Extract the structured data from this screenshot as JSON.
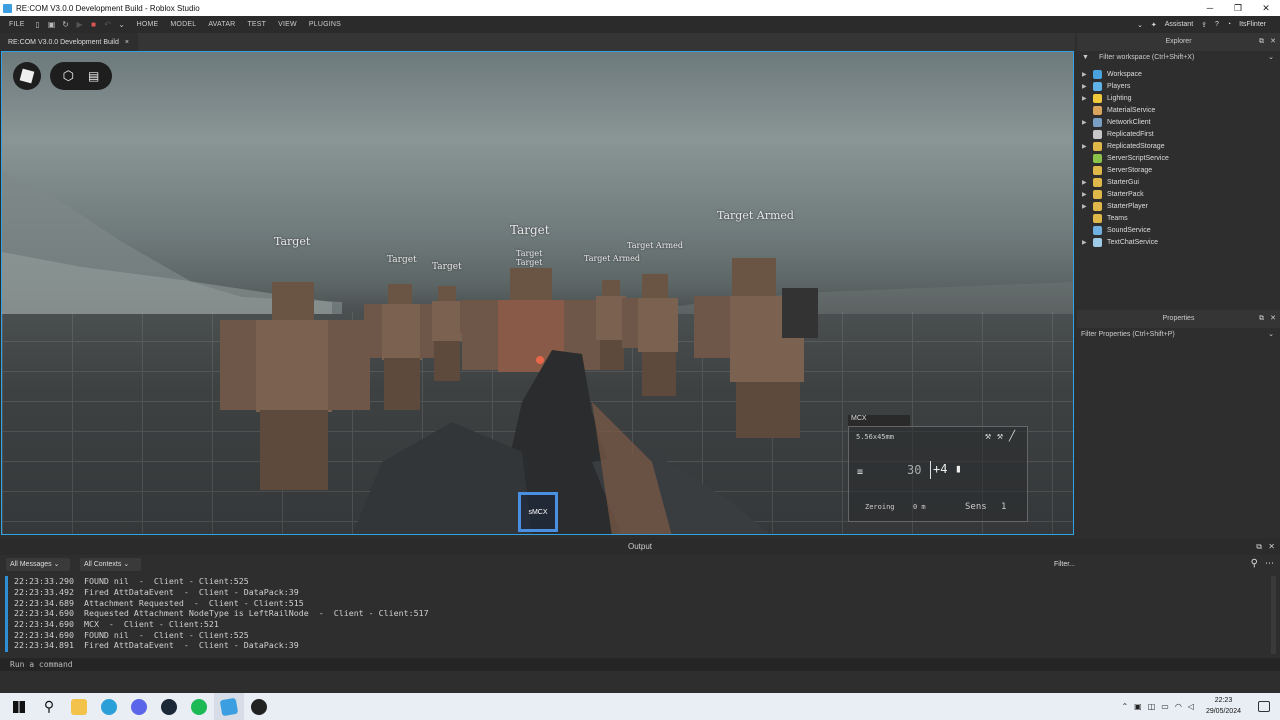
{
  "window": {
    "title": "RE:COM V3.0.0 Development Build - Roblox Studio"
  },
  "menubar": {
    "file": "FILE",
    "tabs": [
      "HOME",
      "MODEL",
      "AVATAR",
      "TEST",
      "VIEW",
      "PLUGINS"
    ],
    "assistant": "Assistant",
    "user": "ItsFlinter"
  },
  "doc_tab": {
    "label": "RE:COM V3.0.0 Development Build",
    "close": "×"
  },
  "viewport": {
    "labels": [
      "Target",
      "Target",
      "Target",
      "Target",
      "Target",
      "Target",
      "Target Armed",
      "Target Armed",
      "Target Armed"
    ],
    "hud": {
      "weapon": "MCX",
      "caliber": "5.56x45mm",
      "ammo": "30",
      "reserve": "+4",
      "zeroing_label": "Zeroing",
      "zeroing_value": "0 m",
      "sens_label": "Sens",
      "sens_value": "1"
    },
    "hotbar_slot": "sMCX"
  },
  "output": {
    "title": "Output",
    "messages_filter": "All Messages",
    "contexts_filter": "All Contexts",
    "filter_placeholder": "Filter...",
    "logs": [
      {
        "time": "22:23:33.290",
        "msg": "FOUND nil  -  Client - Client:525"
      },
      {
        "time": "22:23:33.492",
        "msg": "Fired AttDataEvent  -  Client - DataPack:39"
      },
      {
        "time": "22:23:34.689",
        "msg": "Attachment Requested  -  Client - Client:515"
      },
      {
        "time": "22:23:34.690",
        "msg": "Requested Attachment NodeType is LeftRailNode  -  Client - Client:517"
      },
      {
        "time": "22:23:34.690",
        "msg": "MCX  -  Client - Client:521"
      },
      {
        "time": "22:23:34.690",
        "msg": "FOUND nil  -  Client - Client:525"
      },
      {
        "time": "22:23:34.891",
        "msg": "Fired AttDataEvent  -  Client - DataPack:39"
      }
    ],
    "command_placeholder": "Run a command"
  },
  "explorer": {
    "title": "Explorer",
    "filter": "Filter workspace (Ctrl+Shift+X)",
    "items": [
      {
        "label": "Workspace",
        "expandable": true,
        "color": "#4aa3df"
      },
      {
        "label": "Players",
        "expandable": true,
        "color": "#5fb3e8"
      },
      {
        "label": "Lighting",
        "expandable": true,
        "color": "#f0c93a"
      },
      {
        "label": "MaterialService",
        "expandable": false,
        "color": "#d9a45b"
      },
      {
        "label": "NetworkClient",
        "expandable": true,
        "color": "#7a9fc2"
      },
      {
        "label": "ReplicatedFirst",
        "expandable": false,
        "color": "#c8c8c8"
      },
      {
        "label": "ReplicatedStorage",
        "expandable": true,
        "color": "#e0b84a"
      },
      {
        "label": "ServerScriptService",
        "expandable": false,
        "color": "#8bc34a"
      },
      {
        "label": "ServerStorage",
        "expandable": false,
        "color": "#e0b84a"
      },
      {
        "label": "StarterGui",
        "expandable": true,
        "color": "#e0b84a"
      },
      {
        "label": "StarterPack",
        "expandable": true,
        "color": "#e0b84a"
      },
      {
        "label": "StarterPlayer",
        "expandable": true,
        "color": "#e0b84a"
      },
      {
        "label": "Teams",
        "expandable": false,
        "color": "#e0b84a"
      },
      {
        "label": "SoundService",
        "expandable": false,
        "color": "#6fb1e0"
      },
      {
        "label": "TextChatService",
        "expandable": true,
        "color": "#9ecbe8"
      }
    ]
  },
  "properties": {
    "title": "Properties",
    "filter": "Filter Properties (Ctrl+Shift+P)"
  },
  "taskbar": {
    "time": "22:23",
    "date": "29/05/2024"
  }
}
